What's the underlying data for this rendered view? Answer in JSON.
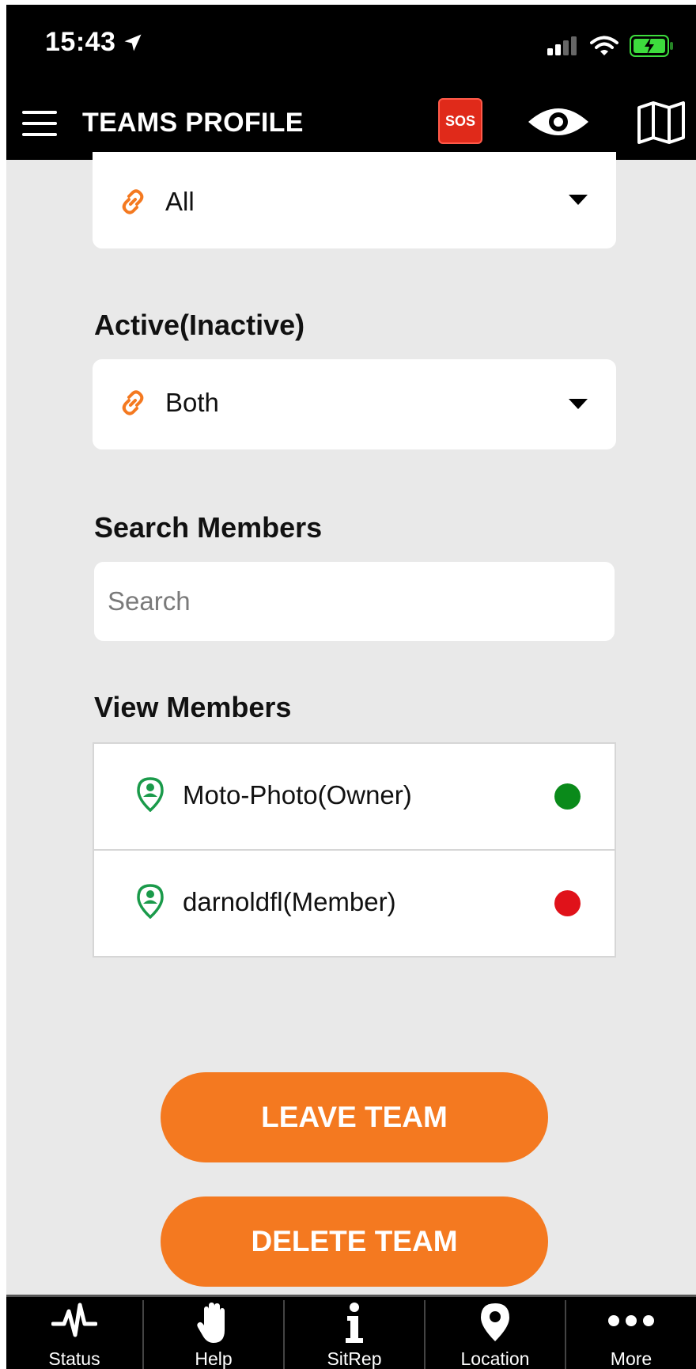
{
  "status_bar": {
    "time": "15:43"
  },
  "app_bar": {
    "title": "TEAMS PROFILE",
    "sos_label": "SOS"
  },
  "filters": {
    "type_dropdown": {
      "value": "All"
    },
    "active_label": "Active(Inactive)",
    "active_dropdown": {
      "value": "Both"
    }
  },
  "search": {
    "label": "Search Members",
    "placeholder": "Search",
    "value": ""
  },
  "members": {
    "label": "View Members",
    "items": [
      {
        "name": "Moto-Photo(Owner)",
        "status_color": "#0a8a1a"
      },
      {
        "name": "darnoldfl(Member)",
        "status_color": "#e0121a"
      }
    ]
  },
  "actions": {
    "leave_label": "LEAVE TEAM",
    "delete_label": "DELETE TEAM"
  },
  "tabs": [
    {
      "label": "Status",
      "icon": "activity-icon"
    },
    {
      "label": "Help",
      "icon": "hand-icon"
    },
    {
      "label": "SitRep",
      "icon": "info-icon"
    },
    {
      "label": "Location",
      "icon": "map-pin-icon"
    },
    {
      "label": "More",
      "icon": "more-icon"
    }
  ],
  "colors": {
    "accent": "#f47920",
    "sos": "#e02a1a",
    "online": "#0a8a1a",
    "offline": "#e0121a",
    "battery": "#3ddc3d"
  }
}
